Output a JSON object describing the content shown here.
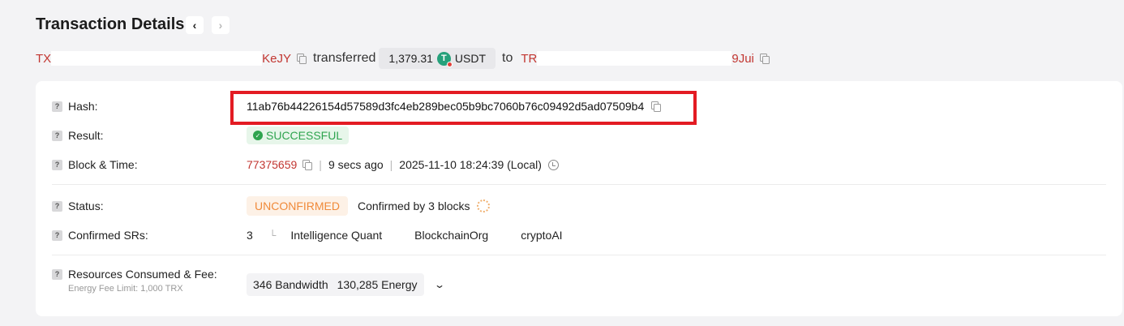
{
  "header": {
    "title": "Transaction Details",
    "prev_icon": "chevron-left-icon",
    "next_icon": "chevron-right-icon"
  },
  "summary": {
    "from_prefix": "TX",
    "from_suffix": "KeJY",
    "transferred_word": "transferred",
    "amount": "1,379.31",
    "token": "USDT",
    "to_word": "to",
    "to_prefix": "TR",
    "to_suffix": "9Jui"
  },
  "details": {
    "hash": {
      "label": "Hash:",
      "value": "11ab76b44226154d57589d3fc4eb289bec05b9bc7060b76c09492d5ad07509b4"
    },
    "result": {
      "label": "Result:",
      "value": "SUCCESSFUL"
    },
    "block_time": {
      "label": "Block & Time:",
      "block": "77375659",
      "ago": "9 secs ago",
      "datetime": "2025-11-10 18:24:39 (Local)"
    },
    "status": {
      "label": "Status:",
      "value": "UNCONFIRMED",
      "confirmations": "Confirmed by 3 blocks"
    },
    "confirmed_srs": {
      "label": "Confirmed SRs:",
      "count": "3",
      "names": [
        "Intelligence Quant",
        "BlockchainOrg",
        "cryptoAI"
      ]
    },
    "resources": {
      "label": "Resources Consumed & Fee:",
      "sub_label": "Energy Fee Limit: 1,000 TRX",
      "bandwidth": "346 Bandwidth",
      "energy": "130,285 Energy"
    }
  },
  "colors": {
    "address_red": "#c23631",
    "success_green": "#2fa44f",
    "unconfirmed_orange": "#f08a3a",
    "highlight_red": "#e31b23",
    "usdt_green": "#26a17b"
  }
}
